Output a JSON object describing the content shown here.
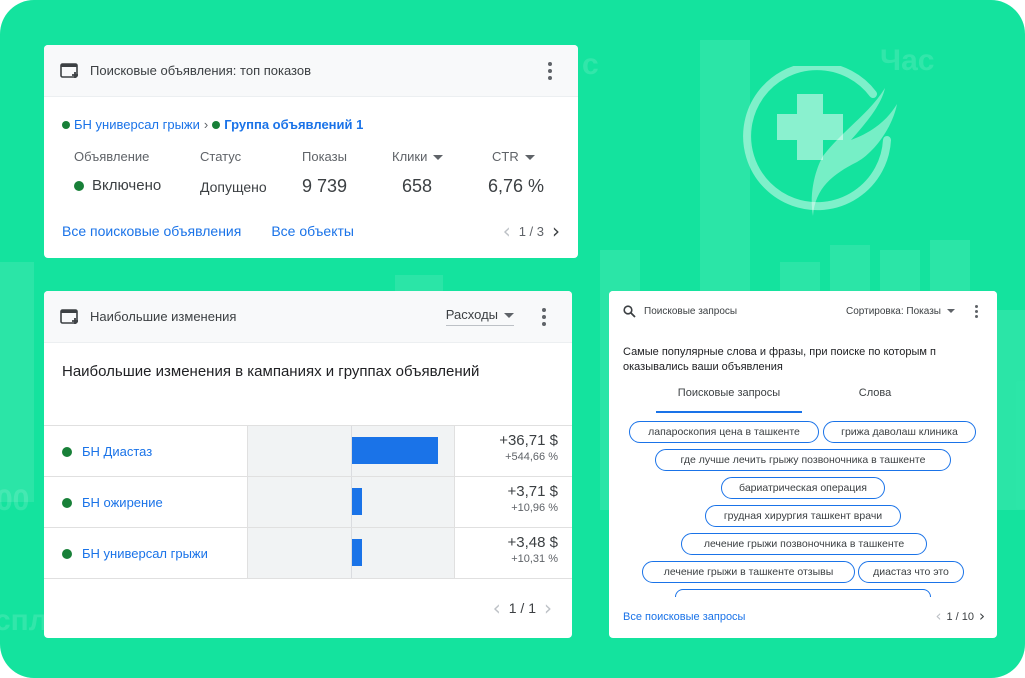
{
  "background": {
    "accent": "#14e39e",
    "watermark_words": [
      "Час",
      "спл",
      "00",
      "с"
    ]
  },
  "top_ads": {
    "title": "Поисковые объявления: топ показов",
    "icon": "ad-card-icon",
    "breadcrumb": {
      "campaign": "БН универсал грыжи",
      "separator": "›",
      "ad_group": "Группа объявлений 1"
    },
    "columns": [
      {
        "label": "Объявление",
        "sortable": false
      },
      {
        "label": "Статус",
        "sortable": false
      },
      {
        "label": "Показы",
        "sortable": false
      },
      {
        "label": "Клики",
        "sortable": true
      },
      {
        "label": "CTR",
        "sortable": true
      }
    ],
    "row": {
      "ad": "Включено",
      "status": "Допущено",
      "impressions": "9 739",
      "clicks": "658",
      "ctr": "6,76 %"
    },
    "links": {
      "all_ads": "Все поисковые объявления",
      "all_objects": "Все объекты"
    },
    "pagination": "1 / 3"
  },
  "biggest_changes": {
    "title": "Наибольшие изменения",
    "metric_select": "Расходы",
    "heading": "Наибольшие изменения в кампаниях и группах объявлений",
    "rows": [
      {
        "name": "БН Диастаз",
        "value": "+36,71 $",
        "percent": "+544,66 %",
        "amount": 36.71
      },
      {
        "name": "БН ожирение",
        "value": "+3,71 $",
        "percent": "+10,96 %",
        "amount": 3.71
      },
      {
        "name": "БН универсал грыжи",
        "value": "+3,48 $",
        "percent": "+10,31 %",
        "amount": 3.48
      }
    ],
    "bar_max": 36.71,
    "bar_color": "#1a73e8",
    "pagination": "1 / 1"
  },
  "search_queries": {
    "title": "Поисковые запросы",
    "sort_label": "Сортировка: Показы",
    "description": "Самые популярные слова и фразы, при поиске по которым п оказывались ваши объявления",
    "tabs": [
      "Поисковые запросы",
      "Слова"
    ],
    "active_tab": 0,
    "chips": [
      "лапароскопия цена в ташкенте",
      "грижа даволаш клиника",
      "где лучше лечить грыжу позвоночника в ташкенте",
      "бариатрическая операция",
      "грудная хирургия ташкент врачи",
      "лечение грыжи позвоночника в ташкенте",
      "лечение грыжи в ташкенте отзывы",
      "диастаз что это"
    ],
    "footer_link": "Все поисковые запросы",
    "pagination": "1 / 10"
  }
}
